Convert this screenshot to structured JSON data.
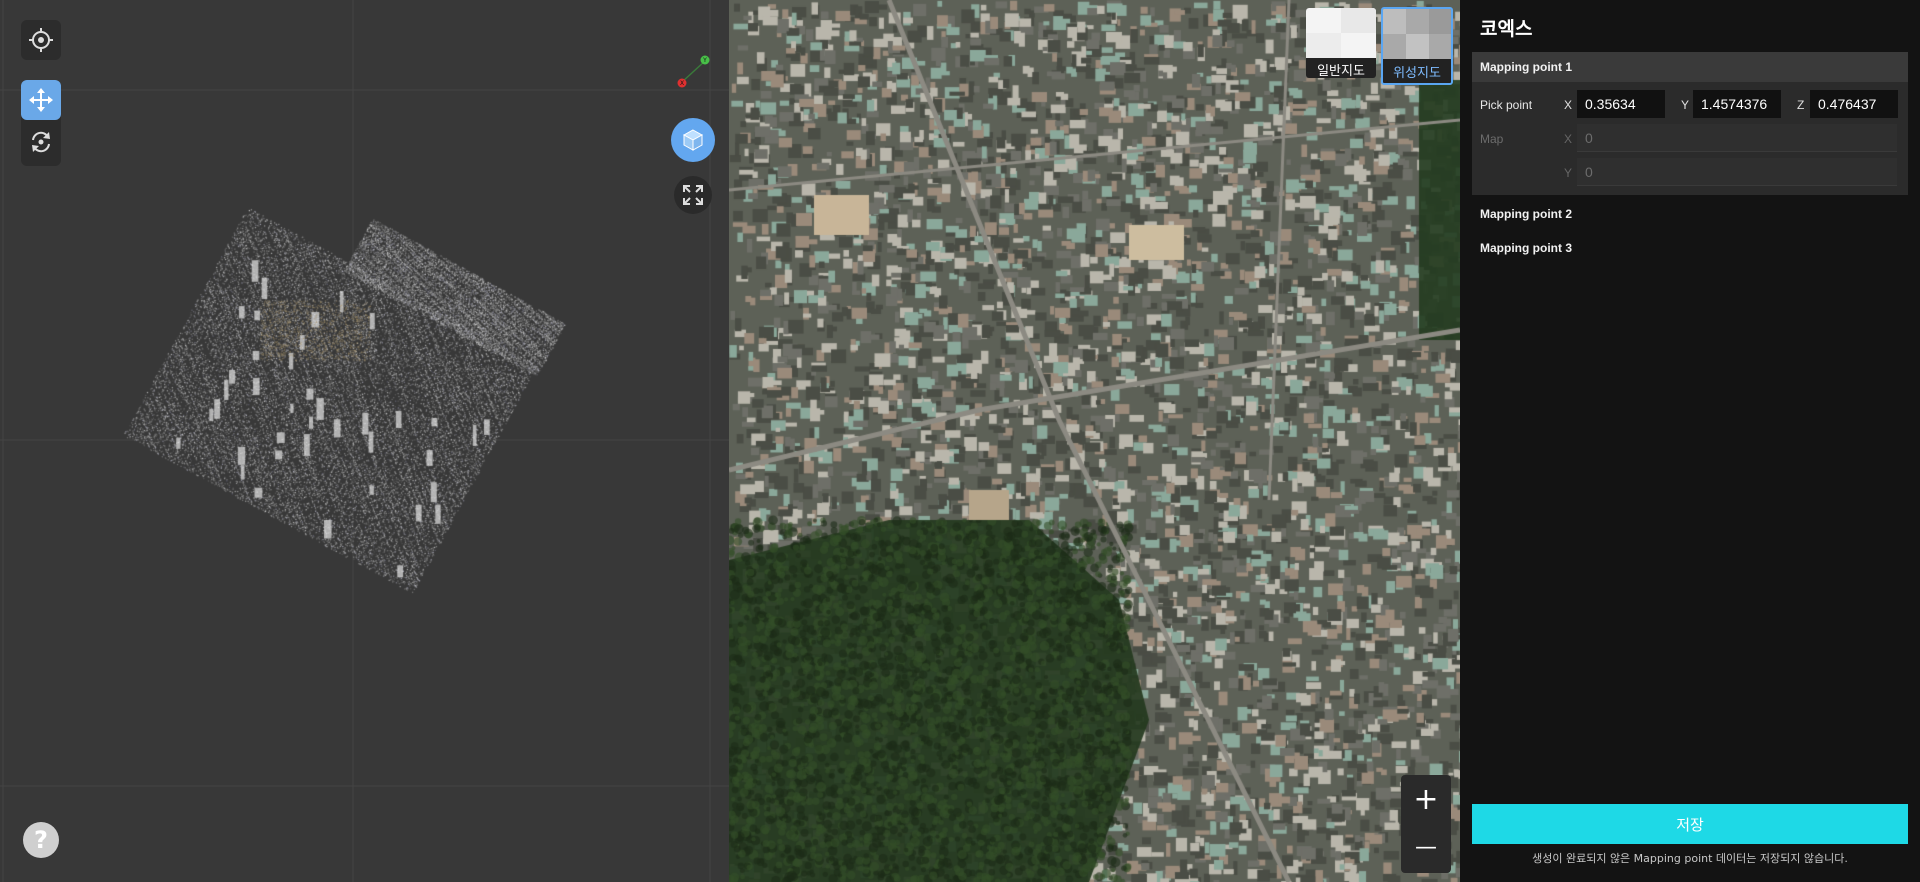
{
  "viewer": {
    "tools": {
      "locate_icon": "crosshair-icon",
      "move_icon": "move-arrows-icon",
      "rotate_icon": "rotate-icon"
    },
    "gizmo": {
      "y_label": "Y",
      "x_label": "X"
    },
    "view_3d_icon": "cube-icon",
    "fit_icon": "expand-corners-icon",
    "help_label": "?"
  },
  "map": {
    "maptypes": [
      {
        "label": "일반지도",
        "selected": false
      },
      {
        "label": "위성지도",
        "selected": true
      }
    ],
    "zoom_in": "+",
    "zoom_out": "—"
  },
  "panel": {
    "title": "코엑스",
    "mapping_points": [
      {
        "name": "Mapping point 1",
        "expanded": true,
        "pick_point_label": "Pick point",
        "pick": {
          "x_label": "X",
          "x": "0.35634",
          "y_label": "Y",
          "y": "1.4574376",
          "z_label": "Z",
          "z": "0.476437"
        },
        "map_label": "Map",
        "map": {
          "x_label": "X",
          "x": "0",
          "y_label": "Y",
          "y": "0"
        }
      },
      {
        "name": "Mapping point 2",
        "expanded": false
      },
      {
        "name": "Mapping point 3",
        "expanded": false
      }
    ],
    "save_label": "저장",
    "footnote": "생성이 완료되지 않은 Mapping point 데이터는 저장되지 않습니다."
  },
  "colors": {
    "accent": "#1ed9e6",
    "tool_active": "#6aa8e8",
    "maptype_selected": "#5aa6f2",
    "viewer_bg": "#383838",
    "panel_bg": "#131313"
  }
}
